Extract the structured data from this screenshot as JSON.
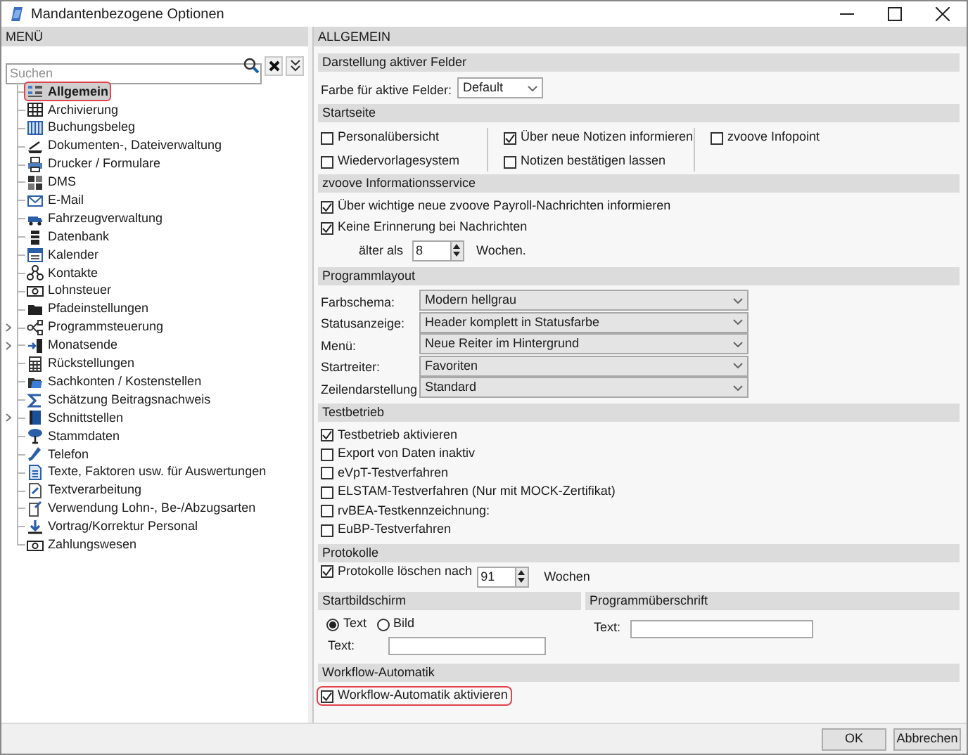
{
  "window": {
    "title": "Mandantenbezogene Optionen"
  },
  "menu": {
    "title": "MENÜ",
    "search": {
      "placeholder": "Suchen"
    },
    "items": [
      {
        "label": "Allgemein",
        "selected": true,
        "highlighted": true,
        "expandable": false
      },
      {
        "label": "Archivierung",
        "selected": false,
        "highlighted": false,
        "expandable": false
      },
      {
        "label": "Buchungsbeleg",
        "selected": false,
        "highlighted": false,
        "expandable": false
      },
      {
        "label": "Dokumenten-, Dateiverwaltung",
        "selected": false,
        "highlighted": false,
        "expandable": false
      },
      {
        "label": "Drucker / Formulare",
        "selected": false,
        "highlighted": false,
        "expandable": false
      },
      {
        "label": "DMS",
        "selected": false,
        "highlighted": false,
        "expandable": false
      },
      {
        "label": "E-Mail",
        "selected": false,
        "highlighted": false,
        "expandable": false
      },
      {
        "label": "Fahrzeugverwaltung",
        "selected": false,
        "highlighted": false,
        "expandable": false
      },
      {
        "label": "Datenbank",
        "selected": false,
        "highlighted": false,
        "expandable": false
      },
      {
        "label": "Kalender",
        "selected": false,
        "highlighted": false,
        "expandable": false
      },
      {
        "label": "Kontakte",
        "selected": false,
        "highlighted": false,
        "expandable": false
      },
      {
        "label": "Lohnsteuer",
        "selected": false,
        "highlighted": false,
        "expandable": false
      },
      {
        "label": "Pfadeinstellungen",
        "selected": false,
        "highlighted": false,
        "expandable": false
      },
      {
        "label": "Programmsteuerung",
        "selected": false,
        "highlighted": false,
        "expandable": true
      },
      {
        "label": "Monatsende",
        "selected": false,
        "highlighted": false,
        "expandable": true
      },
      {
        "label": "Rückstellungen",
        "selected": false,
        "highlighted": false,
        "expandable": false
      },
      {
        "label": "Sachkonten / Kostenstellen",
        "selected": false,
        "highlighted": false,
        "expandable": false
      },
      {
        "label": "Schätzung Beitragsnachweis",
        "selected": false,
        "highlighted": false,
        "expandable": false
      },
      {
        "label": "Schnittstellen",
        "selected": false,
        "highlighted": false,
        "expandable": true
      },
      {
        "label": "Stammdaten",
        "selected": false,
        "highlighted": false,
        "expandable": false
      },
      {
        "label": "Telefon",
        "selected": false,
        "highlighted": false,
        "expandable": false
      },
      {
        "label": "Texte, Faktoren usw. für Auswertungen",
        "selected": false,
        "highlighted": false,
        "expandable": false
      },
      {
        "label": "Textverarbeitung",
        "selected": false,
        "highlighted": false,
        "expandable": false
      },
      {
        "label": "Verwendung Lohn-, Be-/Abzugsarten",
        "selected": false,
        "highlighted": false,
        "expandable": false
      },
      {
        "label": "Vortrag/Korrektur Personal",
        "selected": false,
        "highlighted": false,
        "expandable": false
      },
      {
        "label": "Zahlungswesen",
        "selected": false,
        "highlighted": false,
        "expandable": false
      }
    ]
  },
  "content": {
    "title": "ALLGEMEIN",
    "sections": [
      {
        "kind": "selects",
        "title": "Darstellung aktiver Felder",
        "rows": [
          {
            "label": "Farbe für aktive Felder:",
            "value": "Default"
          }
        ]
      },
      {
        "kind": "columns",
        "title": "Startseite",
        "columns": [
          {
            "items": [
              {
                "label": "Personalübersicht",
                "checked": false,
                "highlighted": false
              },
              {
                "label": "Wiedervorlagesystem",
                "checked": false,
                "highlighted": false
              }
            ]
          },
          {
            "items": [
              {
                "label": "Über neue Notizen informieren",
                "checked": true,
                "highlighted": false
              },
              {
                "label": "Notizen bestätigen lassen",
                "checked": false,
                "highlighted": false
              }
            ]
          },
          {
            "items": [
              {
                "label": "zvoove Infopoint",
                "checked": false,
                "highlighted": false
              }
            ]
          }
        ]
      },
      {
        "kind": "checkboxes",
        "title": "zvoove Informationsservice",
        "items": [
          {
            "label": "Über wichtige neue zvoove Payroll-Nachrichten informieren",
            "checked": true,
            "highlighted": false
          },
          {
            "label": "Keine Erinnerung bei Nachrichten",
            "checked": true,
            "highlighted": false
          }
        ],
        "spinner": {
          "label": "älter als",
          "value": "8",
          "unit": "Wochen."
        }
      },
      {
        "kind": "selects",
        "title": "Programmlayout",
        "rows": [
          {
            "label": "Farbschema:",
            "value": "Modern hellgrau"
          },
          {
            "label": "Statusanzeige:",
            "value": "Header komplett in Statusfarbe"
          },
          {
            "label": "Menü:",
            "value": "Neue Reiter im Hintergrund"
          },
          {
            "label": "Startreiter:",
            "value": "Favoriten"
          },
          {
            "label": "Zeilendarstellung",
            "value": "Standard"
          }
        ]
      },
      {
        "kind": "checkboxes",
        "title": "Testbetrieb",
        "items": [
          {
            "label": "Testbetrieb aktivieren",
            "checked": true,
            "highlighted": false
          },
          {
            "label": "Export von Daten inaktiv",
            "checked": false,
            "highlighted": false
          },
          {
            "label": "eVpT-Testverfahren",
            "checked": false,
            "highlighted": false
          },
          {
            "label": "ELSTAM-Testverfahren (Nur mit MOCK-Zertifikat)",
            "checked": false,
            "highlighted": false
          },
          {
            "label": "rvBEA-Testkennzeichnung:",
            "checked": false,
            "highlighted": false
          },
          {
            "label": "EuBP-Testverfahren",
            "checked": false,
            "highlighted": false
          }
        ]
      },
      {
        "kind": "checkbox_spinner",
        "title": "Protokolle",
        "checkbox": {
          "label": "Protokolle löschen nach",
          "checked": true,
          "highlighted": false
        },
        "value": "91",
        "unit": "Wochen"
      },
      {
        "kind": "split",
        "left": {
          "title": "Startbildschirm",
          "options": [
            {
              "label": "Text",
              "selected": true
            },
            {
              "label": "Bild",
              "selected": false
            }
          ],
          "field_label": "Text:"
        },
        "right": {
          "title": "Programmüberschrift",
          "field_label": "Text:"
        }
      },
      {
        "kind": "checkboxes",
        "title": "Workflow-Automatik",
        "items": [
          {
            "label": "Workflow-Automatik aktivieren",
            "checked": true,
            "highlighted": true
          }
        ]
      }
    ]
  },
  "buttons": [
    {
      "label": "OK"
    },
    {
      "label": "Abbrechen"
    }
  ]
}
